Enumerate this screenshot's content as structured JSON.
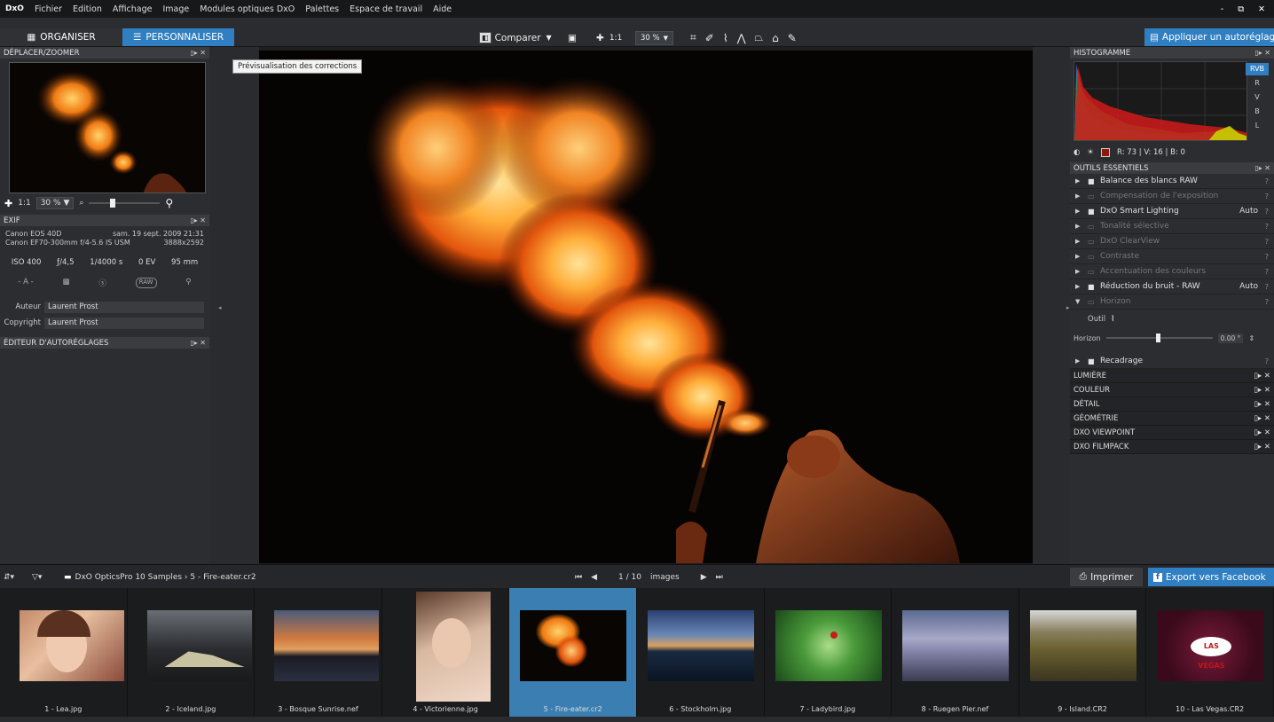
{
  "app": {
    "logo": "DxO"
  },
  "menu": [
    "Fichier",
    "Edition",
    "Affichage",
    "Image",
    "Modules optiques DxO",
    "Palettes",
    "Espace de travail",
    "Aide"
  ],
  "window_controls": {
    "minimize": "-",
    "maximize": "⧉",
    "close": "✕"
  },
  "toolbar": {
    "organise_label": "ORGANISER",
    "customize_label": "PERSONNALISER",
    "compare_label": "Comparer",
    "one_to_one": "1:1",
    "zoom": "30 %",
    "apply_preset_label": "Appliquer un autoréglage"
  },
  "tooltip": "Prévisualisation des corrections",
  "left": {
    "move_zoom_title": "DÉPLACER/ZOOMER",
    "zoom_one": "1:1",
    "zoom_value": "30 %",
    "exif_title": "EXIF",
    "camera": "Canon EOS 40D",
    "date": "sam. 19 sept. 2009 21:31",
    "lens": "Canon EF70-300mm f/4-5.6 IS USM",
    "dimensions": "3888x2592",
    "iso": "ISO 400",
    "aperture": "ƒ/4,5",
    "shutter": "1/4000 s",
    "ev": "0 EV",
    "focal": "95 mm",
    "mode": "- A -",
    "raw": "RAW",
    "author_label": "Auteur",
    "author_value": "Laurent Prost",
    "copyright_label": "Copyright",
    "copyright_value": "Laurent Prost",
    "preset_editor_title": "ÉDITEUR D'AUTORÉGLAGES",
    "panel_controls": "▯▸ ✕"
  },
  "right": {
    "histogram_title": "HISTOGRAMME",
    "channels": [
      "RVB",
      "R",
      "V",
      "B",
      "L"
    ],
    "readout": "R: 73 | V: 16 | B: 0",
    "essential_title": "OUTILS ESSENTIELS",
    "tools": [
      {
        "label": "Balance des blancs RAW",
        "on": true,
        "auto": ""
      },
      {
        "label": "Compensation de l'exposition",
        "on": false,
        "auto": ""
      },
      {
        "label": "DxO Smart Lighting",
        "on": true,
        "auto": "Auto"
      },
      {
        "label": "Tonalité sélective",
        "on": false,
        "auto": ""
      },
      {
        "label": "DxO ClearView",
        "on": false,
        "auto": ""
      },
      {
        "label": "Contraste",
        "on": false,
        "auto": ""
      },
      {
        "label": "Accentuation des couleurs",
        "on": false,
        "auto": ""
      },
      {
        "label": "Réduction du bruit - RAW",
        "on": true,
        "auto": "Auto"
      },
      {
        "label": "Horizon",
        "on": false,
        "auto": ""
      }
    ],
    "horizon_tool_label": "Outil",
    "horizon_label": "Horizon",
    "horizon_value": "0.00 °",
    "crop_label": "Recadrage",
    "sections": [
      "LUMIÈRE",
      "COULEUR",
      "DÉTAIL",
      "GÉOMÉTRIE",
      "DXO VIEWPOINT",
      "DXO FILMPACK"
    ]
  },
  "bottom": {
    "path": "DxO OpticsPro 10 Samples › 5 - Fire-eater.cr2",
    "counter": "1 / 10",
    "counter_unit": "images",
    "print_label": "Imprimer",
    "facebook_label": "Export vers Facebook"
  },
  "filmstrip": [
    {
      "name": "1 - Lea.jpg",
      "selected": false
    },
    {
      "name": "2 - Iceland.jpg",
      "selected": false
    },
    {
      "name": "3 - Bosque Sunrise.nef",
      "selected": false
    },
    {
      "name": "4 - Victorienne.jpg",
      "selected": false
    },
    {
      "name": "5 - Fire-eater.cr2",
      "selected": true
    },
    {
      "name": "6 - Stockholm.jpg",
      "selected": false
    },
    {
      "name": "7 - Ladybird.jpg",
      "selected": false
    },
    {
      "name": "8 - Ruegen Pier.nef",
      "selected": false
    },
    {
      "name": "9 - Island.CR2",
      "selected": false
    },
    {
      "name": "10 - Las Vegas.CR2",
      "selected": false
    }
  ],
  "colors": {
    "accent": "#2f7fc2",
    "panel": "#2b2d30",
    "background": "#1e1f21"
  }
}
